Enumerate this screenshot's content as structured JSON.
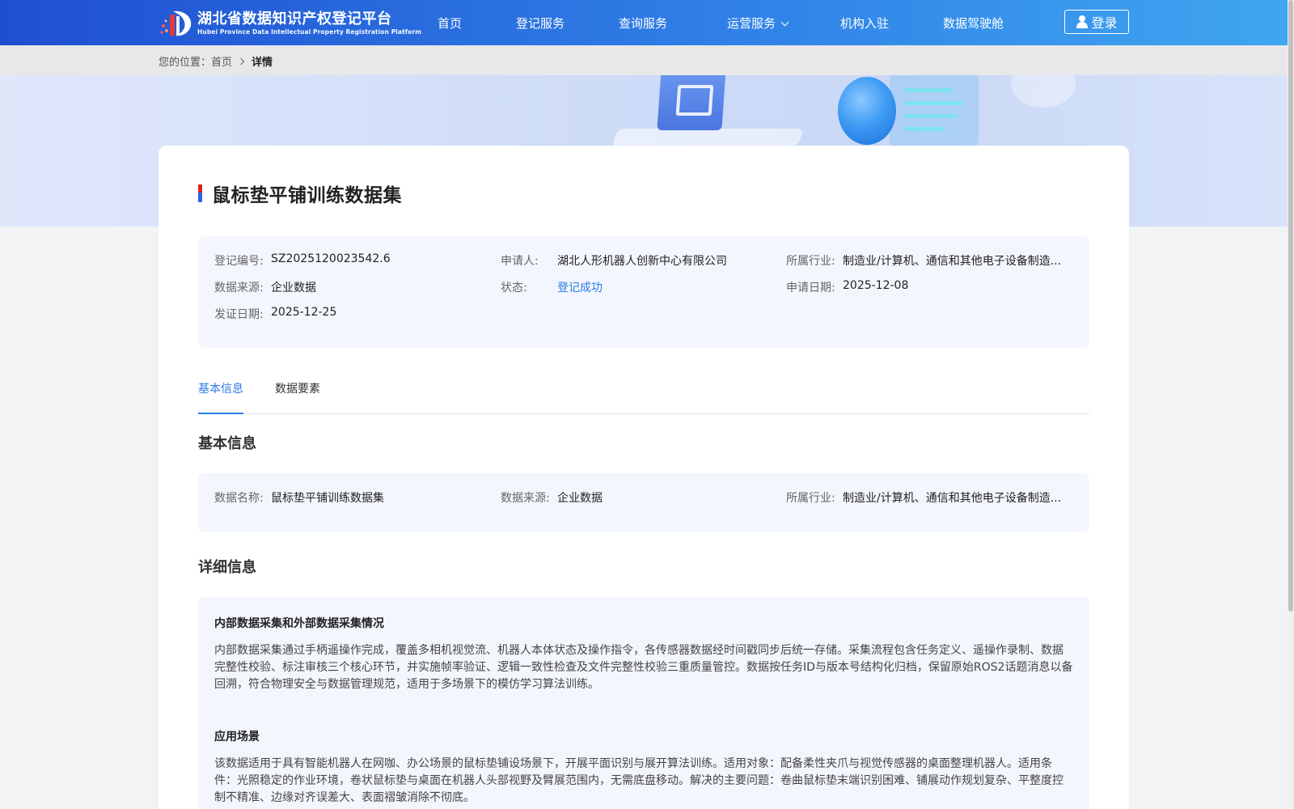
{
  "header": {
    "logo_cn": "湖北省数据知识产权登记平台",
    "logo_en": "Hubei Province Data Intellectual Property Registration Platform",
    "nav": [
      "首页",
      "登记服务",
      "查询服务",
      "运营服务",
      "机构入驻",
      "数据驾驶舱"
    ],
    "login_label": "登录"
  },
  "breadcrumb": {
    "prefix": "您的位置：",
    "home": "首页",
    "current": "详情"
  },
  "detail": {
    "title": "鼠标垫平铺训练数据集",
    "summary": {
      "reg_no_label": "登记编号:",
      "reg_no": "SZ2025120023542.6",
      "applicant_label": "申请人:",
      "applicant": "湖北人形机器人创新中心有限公司",
      "industry_label": "所属行业:",
      "industry": "制造业/计算机、通信和其他电子设备制造...",
      "source_label": "数据来源:",
      "source": "企业数据",
      "status_label": "状态:",
      "status": "登记成功",
      "apply_date_label": "申请日期:",
      "apply_date": "2025-12-08",
      "issue_date_label": "发证日期:",
      "issue_date": "2025-12-25"
    },
    "tabs": [
      "基本信息",
      "数据要素"
    ],
    "basic": {
      "section_title": "基本信息",
      "name_label": "数据名称:",
      "name": "鼠标垫平铺训练数据集",
      "source_label": "数据来源:",
      "source": "企业数据",
      "industry_label": "所属行业:",
      "industry": "制造业/计算机、通信和其他电子设备制造..."
    },
    "detailed": {
      "section_title": "详细信息",
      "collection_title": "内部数据采集和外部数据采集情况",
      "collection_text": "内部数据采集通过手柄遥操作完成，覆盖多相机视觉流、机器人本体状态及操作指令，各传感器数据经时间戳同步后统一存储。采集流程包含任务定义、遥操作录制、数据完整性校验、标注审核三个核心环节，并实施帧率验证、逻辑一致性检查及文件完整性校验三重质量管控。数据按任务ID与版本号结构化归档，保留原始ROS2话题消息以备回溯，符合物理安全与数据管理规范，适用于多场景下的模仿学习算法训练。",
      "scenario_title": "应用场景",
      "scenario_text": "该数据适用于具有智能机器人在网咖、办公场景的鼠标垫铺设场景下，开展平面识别与展开算法训练。适用对象：配备柔性夹爪与视觉传感器的桌面整理机器人。适用条件：光照稳定的作业环境，卷状鼠标垫与桌面在机器人头部视野及臂展范围内，无需底盘移动。解决的主要问题：卷曲鼠标垫末端识别困难、铺展动作规划复杂、平整度控制不精准、边缘对齐误差大、表面褶皱消除不彻底。"
    }
  },
  "colors": {
    "header_start": "#1f4fd1",
    "header_end": "#3fa6f0",
    "accent": "#2a7ae8",
    "panel_bg": "#f3f6fd"
  }
}
